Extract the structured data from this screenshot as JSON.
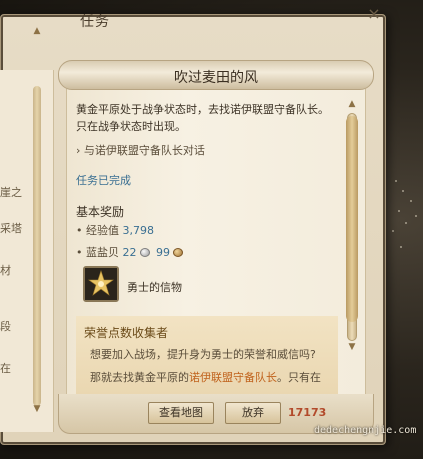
{
  "window": {
    "title": "任务",
    "close_label": "×"
  },
  "sidebar": {
    "fragments": [
      "崖之",
      "采塔",
      "材",
      "段",
      "在"
    ]
  },
  "quest": {
    "title": "吹过麦田的风",
    "description": "黄金平原处于战争状态时，去找诺伊联盟守备队长。只在战争状态时出现。",
    "objective": "与诺伊联盟守备队长对话",
    "status": "任务已完成"
  },
  "rewards": {
    "section_title": "基本奖励",
    "exp_label": "经验值",
    "exp_value": "3,798",
    "currency_label": "蓝盐贝",
    "currency_value_1": "22",
    "currency_value_2": "99",
    "item_name": "勇士的信物"
  },
  "hint": {
    "title": "荣誉点数收集者",
    "line1": "想要加入战场，提升身为勇士的荣誉和威信吗?",
    "line2_prefix": "那就去找黄金平原的",
    "line2_link": "诺伊联盟守备队长",
    "line2_suffix": "。只有在"
  },
  "buttons": {
    "view_map": "查看地图",
    "abandon": "放弃"
  },
  "watermark": {
    "logo": "17173",
    "text": "dedechengnjie.com"
  },
  "icons": {
    "coin_silver": "silver-coin-icon",
    "coin_bronze": "bronze-coin-icon",
    "item": "emblem-item-icon"
  },
  "colors": {
    "accent_blue": "#3a6f92",
    "accent_orange": "#c0621c",
    "hint_title": "#6a4a18"
  }
}
